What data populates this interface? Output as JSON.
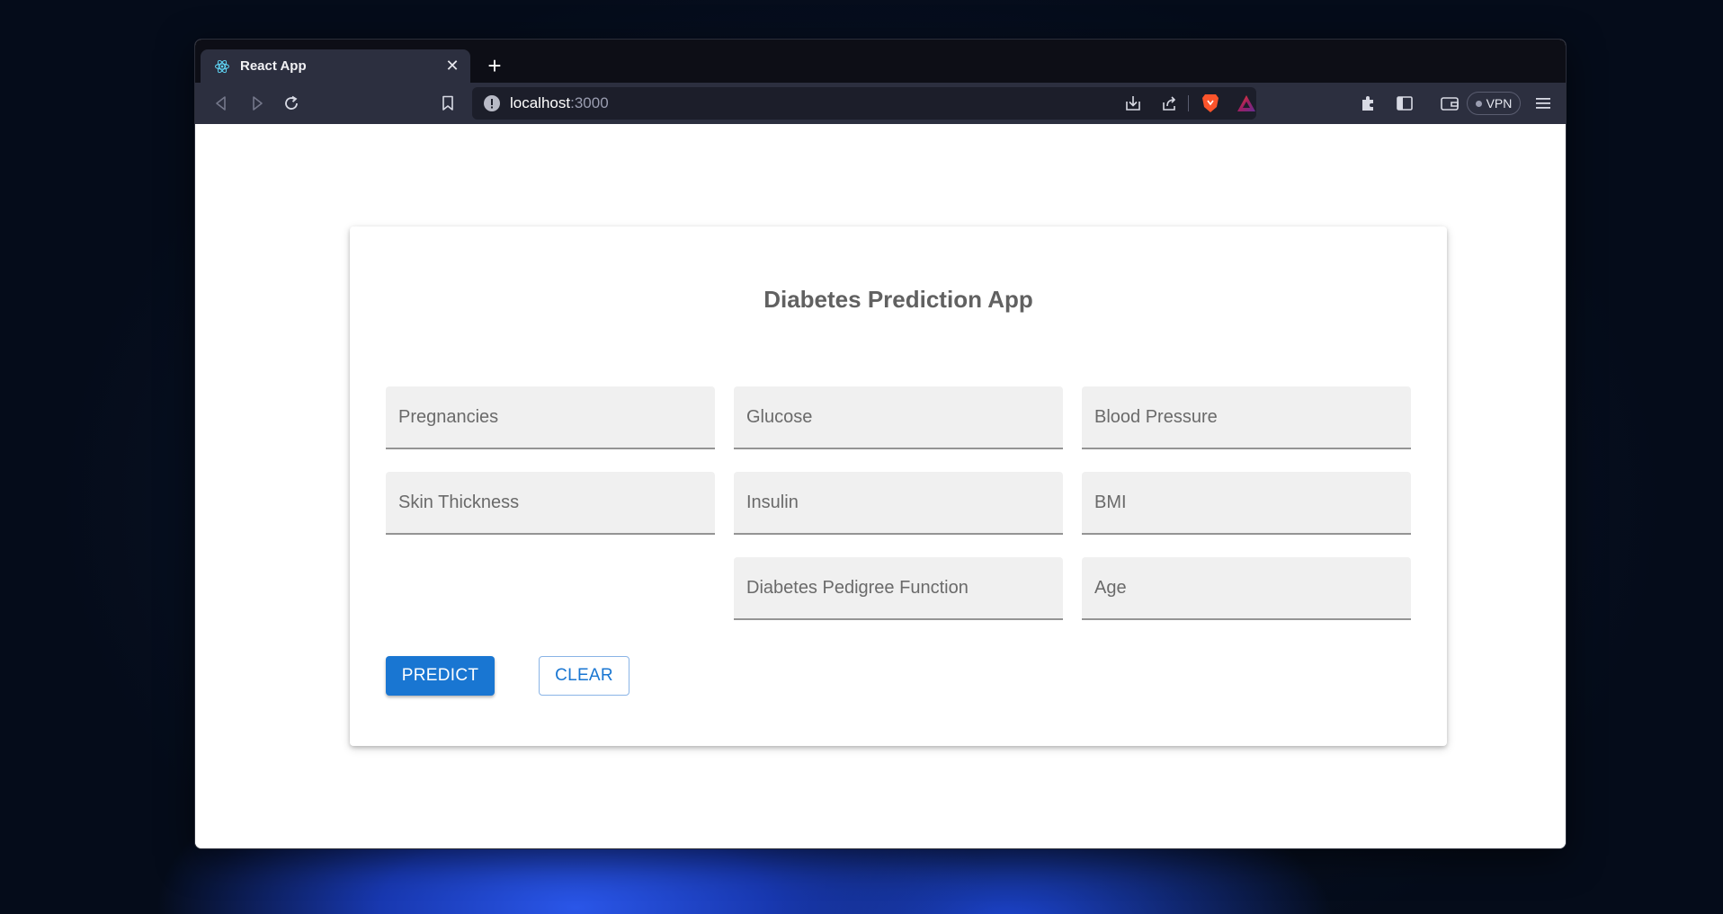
{
  "browser": {
    "tab_title": "React App",
    "url_host": "localhost",
    "url_port": ":3000",
    "vpn_label": "VPN"
  },
  "app": {
    "title": "Diabetes Prediction App",
    "fields": {
      "pregnancies": "Pregnancies",
      "glucose": "Glucose",
      "blood_pressure": "Blood Pressure",
      "skin_thickness": "Skin Thickness",
      "insulin": "Insulin",
      "bmi": "BMI",
      "dpf": "Diabetes Pedigree Function",
      "age": "Age"
    },
    "predict_label": "PREDICT",
    "clear_label": "CLEAR"
  },
  "colors": {
    "primary": "#1976d2",
    "field_bg": "#f0f0f0",
    "browser_chrome": "#2c2f3f"
  },
  "icons": [
    "react-icon",
    "tab-close-icon",
    "new-tab-icon",
    "chevron-down-icon",
    "minimize-icon",
    "maximize-icon",
    "close-icon",
    "back-icon",
    "forward-icon",
    "reload-icon",
    "bookmark-icon",
    "info-icon",
    "download-icon",
    "share-icon",
    "brave-shield-icon",
    "brave-rewards-icon",
    "extensions-icon",
    "sidebar-icon",
    "wallet-icon",
    "menu-icon"
  ]
}
